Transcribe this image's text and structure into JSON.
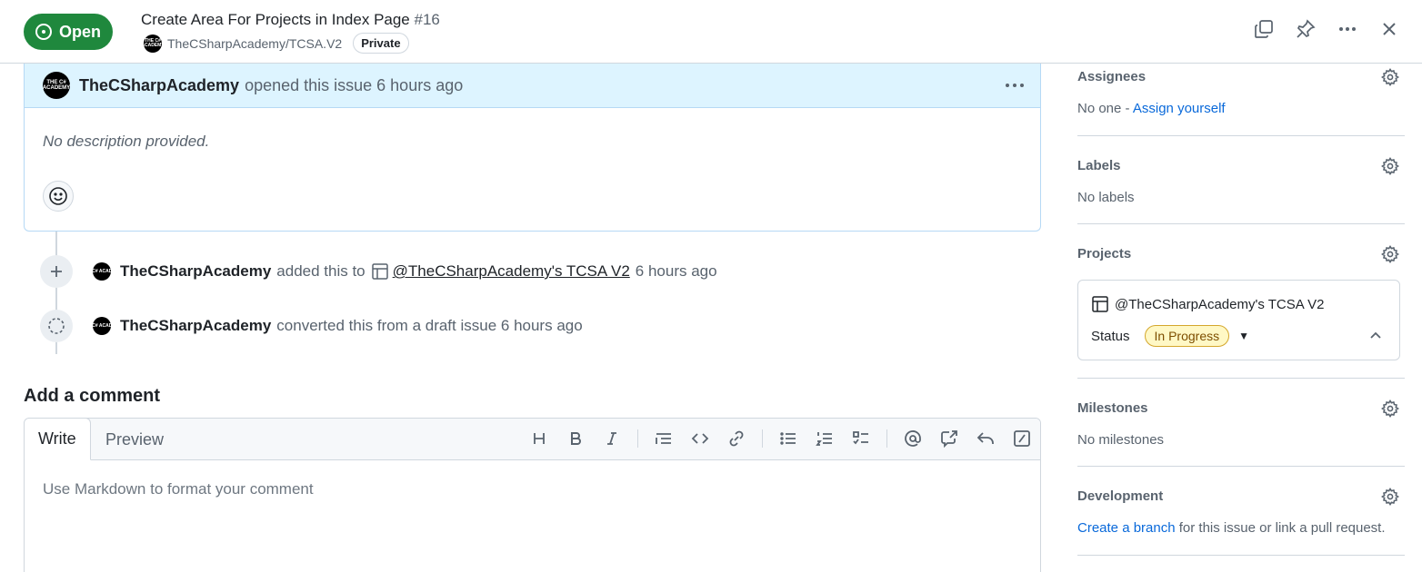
{
  "header": {
    "state_label": "Open",
    "title": "Create Area For Projects in Index Page",
    "number": "#16",
    "repo": "TheCSharpAcademy/TCSA.V2",
    "visibility": "Private",
    "actions": [
      "copy-icon",
      "pin-icon",
      "kebab-horizontal-icon",
      "close-icon"
    ]
  },
  "issue": {
    "author": "TheCSharpAcademy",
    "action_text": "opened this issue 6 hours ago",
    "description": "No description provided."
  },
  "avatar_text": "THE C# ACADEMY",
  "timeline": [
    {
      "icon": "plus-icon",
      "author": "TheCSharpAcademy",
      "text_before": "added this to",
      "project": "@TheCSharpAcademy's TCSA V2",
      "text_after": "6 hours ago"
    },
    {
      "icon": "dashed-circle-icon",
      "author": "TheCSharpAcademy",
      "text": "converted this from a draft issue 6 hours ago"
    }
  ],
  "comment": {
    "heading": "Add a comment",
    "tabs": [
      "Write",
      "Preview"
    ],
    "placeholder": "Use Markdown to format your comment",
    "toolbar": [
      "heading-icon",
      "bold-icon",
      "italic-icon",
      "quote-icon",
      "code-icon",
      "link-icon",
      "unordered-list-icon",
      "ordered-list-icon",
      "tasklist-icon",
      "mention-icon",
      "cross-reference-icon",
      "reply-icon",
      "slash-command-icon"
    ]
  },
  "sidebar": {
    "assignees": {
      "title": "Assignees",
      "none": "No one - ",
      "action": "Assign yourself"
    },
    "labels": {
      "title": "Labels",
      "value": "No labels"
    },
    "projects": {
      "title": "Projects",
      "project_name": "@TheCSharpAcademy's TCSA V2",
      "status_label": "Status",
      "status_value": "In Progress"
    },
    "milestones": {
      "title": "Milestones",
      "value": "No milestones"
    },
    "development": {
      "title": "Development",
      "link": "Create a branch",
      "rest": " for this issue or link a pull request."
    }
  },
  "colors": {
    "open_green": "#1f883d",
    "link_blue": "#0969da",
    "header_tint": "#ddf4ff",
    "status_yellow": "#fff8c5"
  }
}
